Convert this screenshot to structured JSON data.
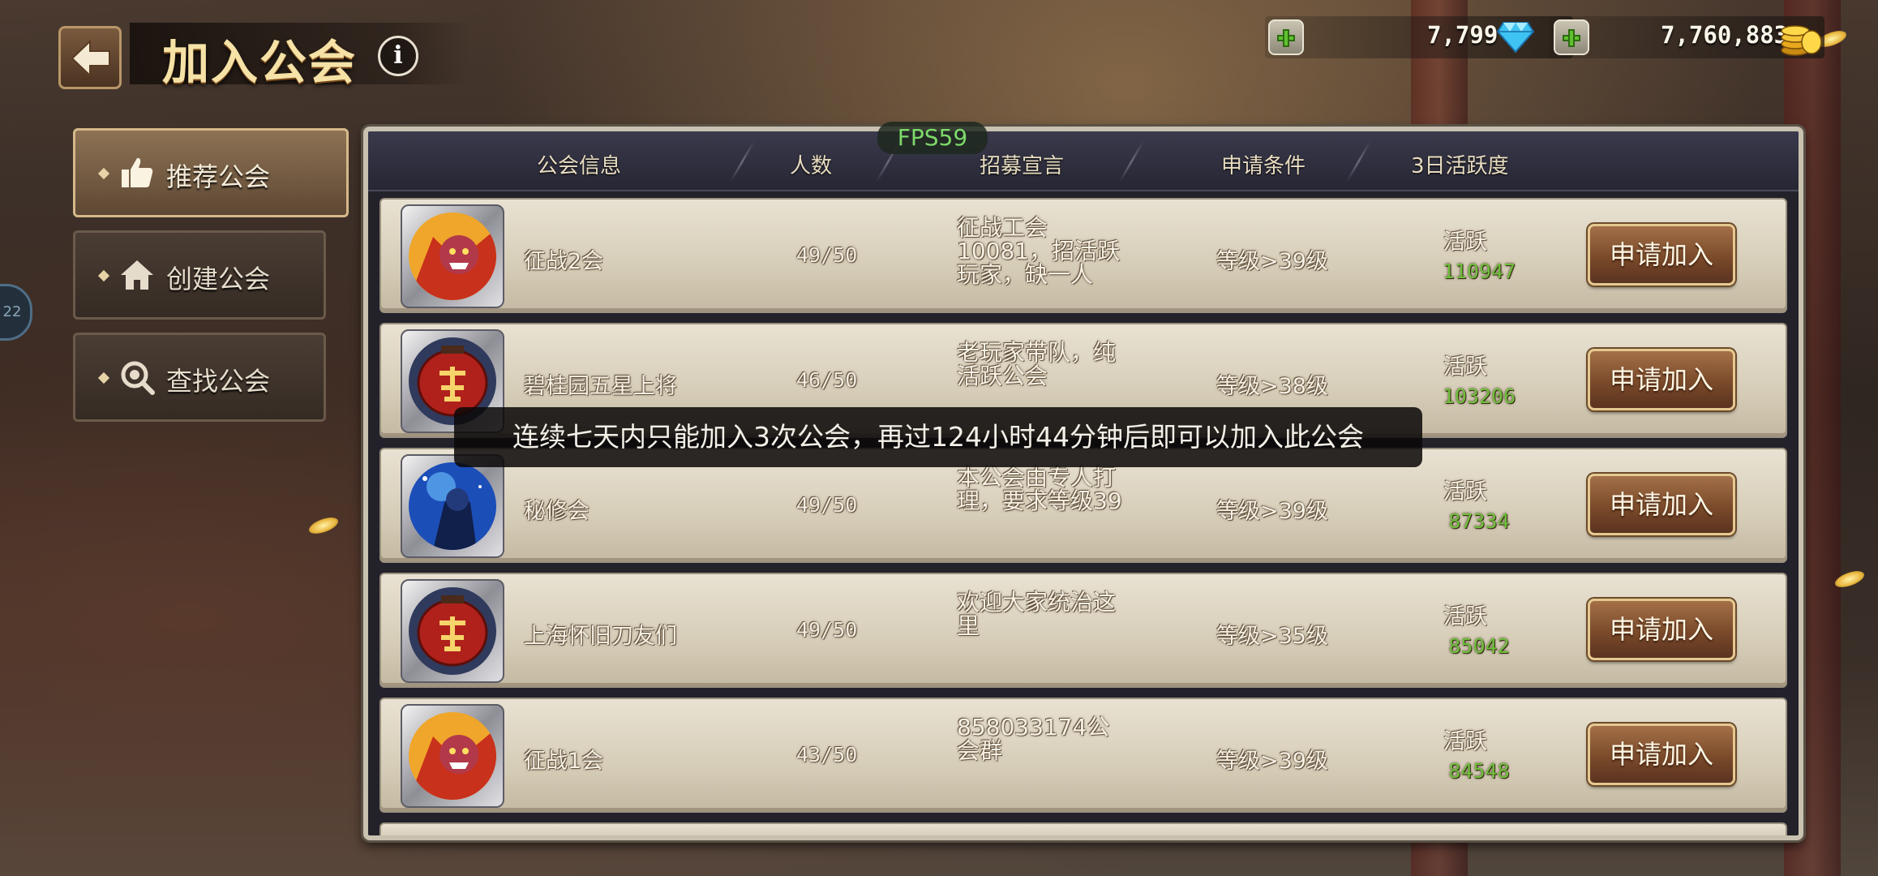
{
  "header": {
    "title": "加入公会",
    "info_icon": "i",
    "gems": "7,799",
    "gold": "7,760,883"
  },
  "sidebar": {
    "items": [
      {
        "label": "推荐公会",
        "icon": "thumbs-up-icon",
        "active": true
      },
      {
        "label": "创建公会",
        "icon": "home-icon",
        "active": false
      },
      {
        "label": "查找公会",
        "icon": "magnifier-icon",
        "active": false
      }
    ],
    "edge_badge": "22"
  },
  "fps": "FPS59",
  "table": {
    "columns": [
      "公会信息",
      "人数",
      "招募宣言",
      "申请条件",
      "3日活跃度"
    ],
    "rows": [
      {
        "name": "征战2会",
        "count": "49/50",
        "slogan": "征战工会10081，招活跃玩家，缺一人",
        "condition": "等级>39级",
        "activity_label": "活跃",
        "activity": "110947",
        "button": "申请加入",
        "avatar": "demon-warrior"
      },
      {
        "name": "碧桂园五星上将",
        "count": "46/50",
        "slogan": "老玩家带队，纯活跃公会",
        "condition": "等级>38级",
        "activity_label": "活跃",
        "activity": "103206",
        "button": "申请加入",
        "avatar": "red-lantern"
      },
      {
        "name": "秘修会",
        "count": "49/50",
        "slogan": "本公会由专人打理，要求等级39",
        "condition": "等级>39级",
        "activity_label": "活跃",
        "activity": "87334",
        "button": "申请加入",
        "avatar": "blue-mage"
      },
      {
        "name": "上海怀旧刀友们",
        "count": "49/50",
        "slogan": "欢迎大家统治这里",
        "condition": "等级>35级",
        "activity_label": "活跃",
        "activity": "85042",
        "button": "申请加入",
        "avatar": "red-lantern"
      },
      {
        "name": "征战1会",
        "count": "43/50",
        "slogan": "858033174公会群",
        "condition": "等级>39级",
        "activity_label": "活跃",
        "activity": "84548",
        "button": "申请加入",
        "avatar": "demon-warrior"
      }
    ]
  },
  "toast": "连续七天内只能加入3次公会，再过124小时44分钟后即可以加入此公会",
  "colors": {
    "accent_gold": "#f6e2a6",
    "activity_green": "#6fbe3c",
    "button_brown": "#7a4a2a",
    "row_parchment": "#d6cdb8"
  }
}
